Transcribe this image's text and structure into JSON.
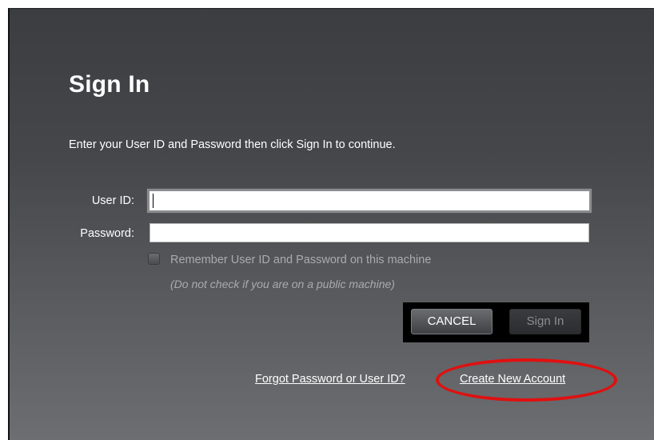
{
  "dialog": {
    "title": "Sign In",
    "instructions": "Enter your User ID and Password then click Sign In to continue."
  },
  "form": {
    "user_id_label": "User ID:",
    "user_id_value": "",
    "password_label": "Password:",
    "password_value": "",
    "remember_label": "Remember User ID and Password on this machine",
    "remember_checked": false,
    "remember_hint": "(Do not check if you are on a public machine)"
  },
  "buttons": {
    "cancel_label": "CANCEL",
    "signin_label": "Sign In"
  },
  "links": {
    "forgot_label": "Forgot Password or User ID?",
    "create_label": "Create New Account"
  },
  "colors": {
    "dialog_background": "#45474a",
    "highlight_ring": "#e01010",
    "disabled_text": "#a9abae"
  }
}
